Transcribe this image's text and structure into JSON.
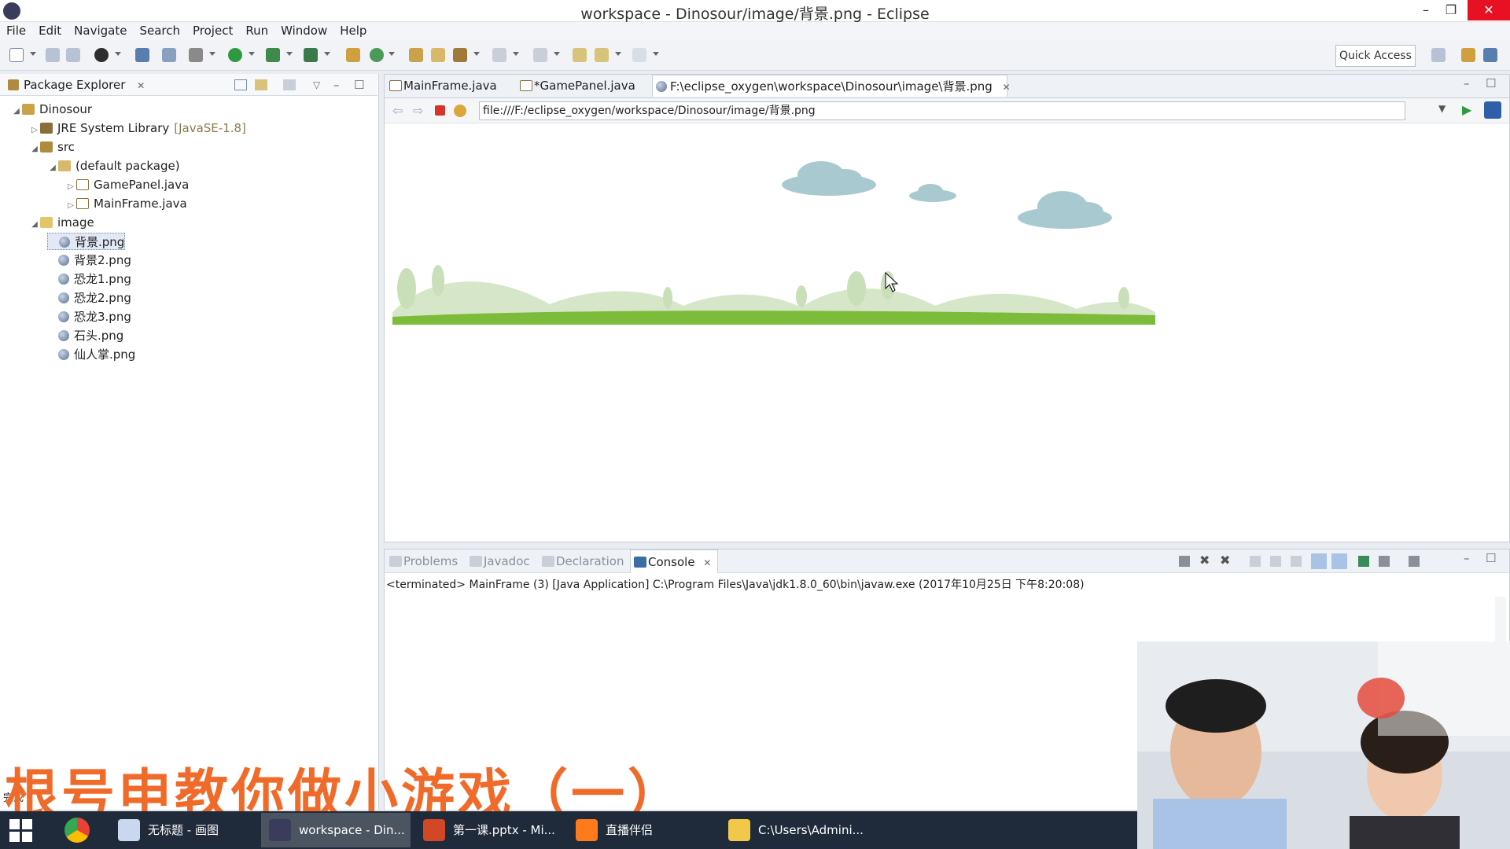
{
  "window": {
    "title": "workspace - Dinosour/image/背景.png - Eclipse"
  },
  "menu": [
    "File",
    "Edit",
    "Navigate",
    "Search",
    "Project",
    "Run",
    "Window",
    "Help"
  ],
  "toolbar": {
    "quick_access": "Quick Access"
  },
  "package_explorer": {
    "title": "Package Explorer",
    "tree": [
      {
        "label": "Dinosour",
        "depth": 0,
        "expanded": true,
        "icon": "project-icon"
      },
      {
        "label": "JRE System Library",
        "extra": "[JavaSE-1.8]",
        "depth": 1,
        "expanded": false,
        "icon": "library-icon"
      },
      {
        "label": "src",
        "depth": 1,
        "expanded": true,
        "icon": "source-folder-icon"
      },
      {
        "label": "(default package)",
        "depth": 2,
        "expanded": true,
        "icon": "package-icon"
      },
      {
        "label": "GamePanel.java",
        "depth": 3,
        "expanded": false,
        "icon": "java-file-icon"
      },
      {
        "label": "MainFrame.java",
        "depth": 3,
        "expanded": false,
        "icon": "java-file-icon"
      },
      {
        "label": "image",
        "depth": 1,
        "expanded": true,
        "icon": "folder-icon"
      },
      {
        "label": "背景.png",
        "depth": 2,
        "icon": "image-file-icon",
        "selected": true
      },
      {
        "label": "背景2.png",
        "depth": 2,
        "icon": "image-file-icon"
      },
      {
        "label": "恐龙1.png",
        "depth": 2,
        "icon": "image-file-icon"
      },
      {
        "label": "恐龙2.png",
        "depth": 2,
        "icon": "image-file-icon"
      },
      {
        "label": "恐龙3.png",
        "depth": 2,
        "icon": "image-file-icon"
      },
      {
        "label": "石头.png",
        "depth": 2,
        "icon": "image-file-icon"
      },
      {
        "label": "仙人掌.png",
        "depth": 2,
        "icon": "image-file-icon"
      }
    ]
  },
  "editor": {
    "tabs": [
      {
        "label": "MainFrame.java",
        "active": false
      },
      {
        "label": "*GamePanel.java",
        "active": false
      },
      {
        "label": "F:\\eclipse_oxygen\\workspace\\Dinosour\\image\\背景.png",
        "active": true
      }
    ],
    "address": "file:///F:/eclipse_oxygen/workspace/Dinosour/image/背景.png"
  },
  "bottom_panel": {
    "tabs": [
      {
        "label": "Problems",
        "active": false
      },
      {
        "label": "Javadoc",
        "active": false
      },
      {
        "label": "Declaration",
        "active": false
      },
      {
        "label": "Console",
        "active": true
      }
    ],
    "console_text": "<terminated> MainFrame (3) [Java Application] C:\\Program Files\\Java\\jdk1.8.0_60\\bin\\javaw.exe (2017年10月25日 下午8:20:08)"
  },
  "overlay": {
    "title": "根号申教你做小游戏（一）"
  },
  "status": {
    "left_text": "完成"
  },
  "taskbar": {
    "items": [
      {
        "label": "无标题 - 画图",
        "active": false
      },
      {
        "label": "workspace - Din...",
        "active": true
      },
      {
        "label": "第一课.pptx - Mi...",
        "active": false
      },
      {
        "label": "直播伴侣",
        "active": false
      },
      {
        "label": "C:\\Users\\Admini...",
        "active": false
      }
    ]
  },
  "colors": {
    "accent": "#3a6ea5",
    "overlay_text": "#f06a2a",
    "grass": "#7dbb3a",
    "cloud": "#a9c9d1"
  }
}
